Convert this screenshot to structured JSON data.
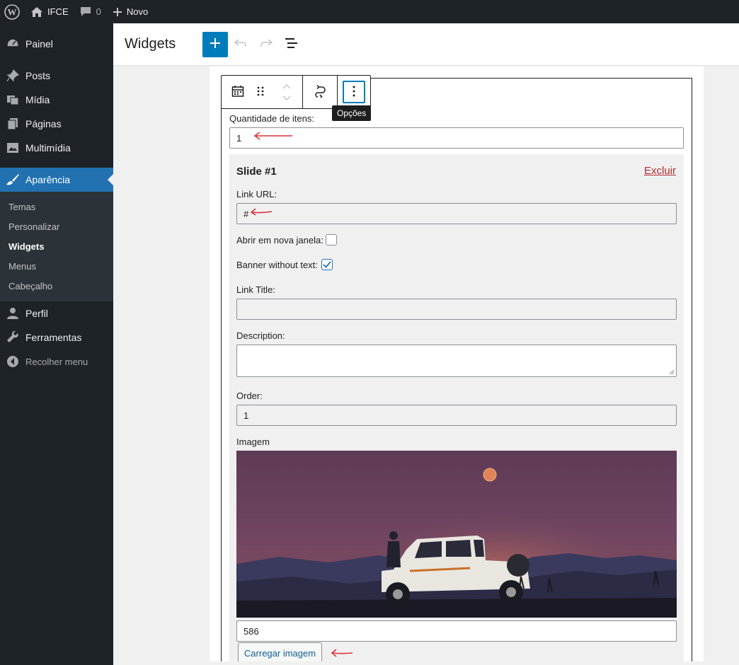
{
  "admin_bar": {
    "site_name": "IFCE",
    "comments_count": "0",
    "new_label": "Novo"
  },
  "sidebar": {
    "items": [
      {
        "label": "Painel",
        "icon": "dashboard-icon"
      },
      {
        "label": "Posts",
        "icon": "pin-icon"
      },
      {
        "label": "Mídia",
        "icon": "media-icon"
      },
      {
        "label": "Páginas",
        "icon": "pages-icon"
      },
      {
        "label": "Multimídia",
        "icon": "multimedia-icon"
      },
      {
        "label": "Aparência",
        "icon": "appearance-brush-icon",
        "active": true
      }
    ],
    "submenu": [
      "Temas",
      "Personalizar",
      "Widgets",
      "Menus",
      "Cabeçalho"
    ],
    "submenu_current": "Widgets",
    "lower_items": [
      {
        "label": "Perfil",
        "icon": "user-icon"
      },
      {
        "label": "Ferramentas",
        "icon": "wrench-icon"
      },
      {
        "label": "Recolher menu",
        "icon": "collapse-icon"
      }
    ]
  },
  "header": {
    "title": "Widgets"
  },
  "toolbar": {
    "tooltip": "Opções"
  },
  "form": {
    "quantity_label": "Quantidade de itens:",
    "quantity_value": "1",
    "slide_title": "Slide #1",
    "delete_label": "Excluir",
    "link_url_label": "Link URL:",
    "link_url_value": "#",
    "new_window_label": "Abrir em nova janela:",
    "new_window_checked": false,
    "banner_label": "Banner without text:",
    "banner_checked": true,
    "link_title_label": "Link Title:",
    "link_title_value": "",
    "description_label": "Description:",
    "description_value": "",
    "order_label": "Order:",
    "order_value": "1",
    "image_label": "Imagem",
    "image_id_value": "586",
    "upload_label": "Carregar imagem"
  },
  "colors": {
    "admin_dark": "#1d2327",
    "accent": "#2271b1",
    "delete": "#b32d2e",
    "annotation_arrow": "#d63638"
  }
}
